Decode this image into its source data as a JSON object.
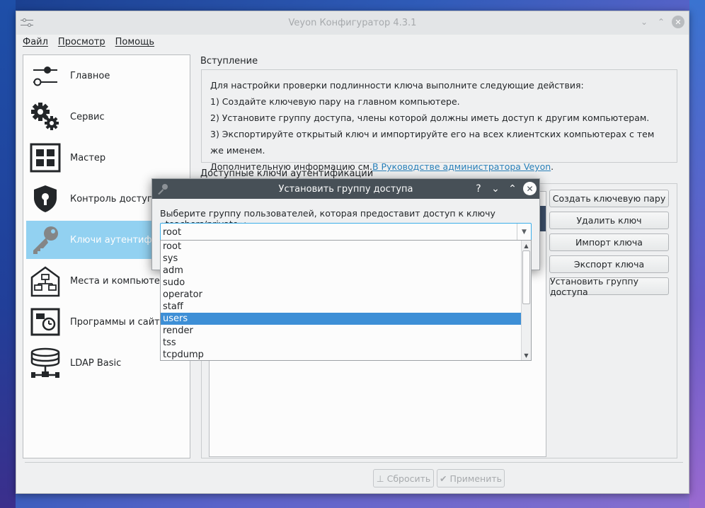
{
  "window": {
    "title": "Veyon Конфигуратор 4.3.1",
    "controls": {
      "minimize": "⌄",
      "maximize": "⌃",
      "close": "✕"
    }
  },
  "menu": [
    "Файл",
    "Просмотр",
    "Помощь"
  ],
  "sidebar": {
    "items": [
      {
        "label": "Главное",
        "icon": "sliders-icon"
      },
      {
        "label": "Сервис",
        "icon": "gears-icon"
      },
      {
        "label": "Мастер",
        "icon": "grid-icon"
      },
      {
        "label": "Контроль доступа",
        "icon": "shield-lock-icon"
      },
      {
        "label": "Ключи аутентификации",
        "icon": "key-icon"
      },
      {
        "label": "Места и компьютеры",
        "icon": "house-network-icon"
      },
      {
        "label": "Программы и сайты",
        "icon": "monitor-clock-icon"
      },
      {
        "label": "LDAP Basic",
        "icon": "database-network-icon"
      }
    ],
    "selected_index": 4
  },
  "intro": {
    "title": "Вступление",
    "lines": [
      "Для настройки проверки подлинности ключа выполните следующие действия:",
      "1) Создайте ключевую пару на главном компьютере.",
      "2) Установите группу доступа, члены которой должны иметь доступ к другим компьютерам.",
      "3) Экспортируйте открытый ключ и импортируйте его на всех клиентских компьютерах с тем же именем."
    ],
    "more_prefix": "Дополнительную информацию см.",
    "more_link": "В Руководстве администратора Veyon",
    "more_suffix": "."
  },
  "keys": {
    "title": "Доступные ключи аутентификации",
    "buttons": {
      "create": "Создать ключевую пару",
      "delete": "Удалить ключ",
      "import": "Импорт ключа",
      "export": "Экспорт ключа",
      "set_group": "Установить группу доступа"
    }
  },
  "footer": {
    "reset": "Сбросить",
    "apply": "Применить"
  },
  "dialog": {
    "title": "Установить группу доступа",
    "controls": {
      "help": "?",
      "minimize": "⌄",
      "maximize": "⌃",
      "close": "✕"
    },
    "prompt": "Выберите группу пользователей, которая предоставит доступ к ключу «teachers/private»:",
    "combo_value": "root",
    "options": [
      "root",
      "sys",
      "adm",
      "sudo",
      "operator",
      "staff",
      "users",
      "render",
      "tss",
      "tcpdump"
    ],
    "highlighted_index": 6
  },
  "colors": {
    "accent": "#3daee9",
    "dialog_titlebar": "#475057",
    "selection": "#3d8fd6",
    "link": "#2980b9"
  }
}
